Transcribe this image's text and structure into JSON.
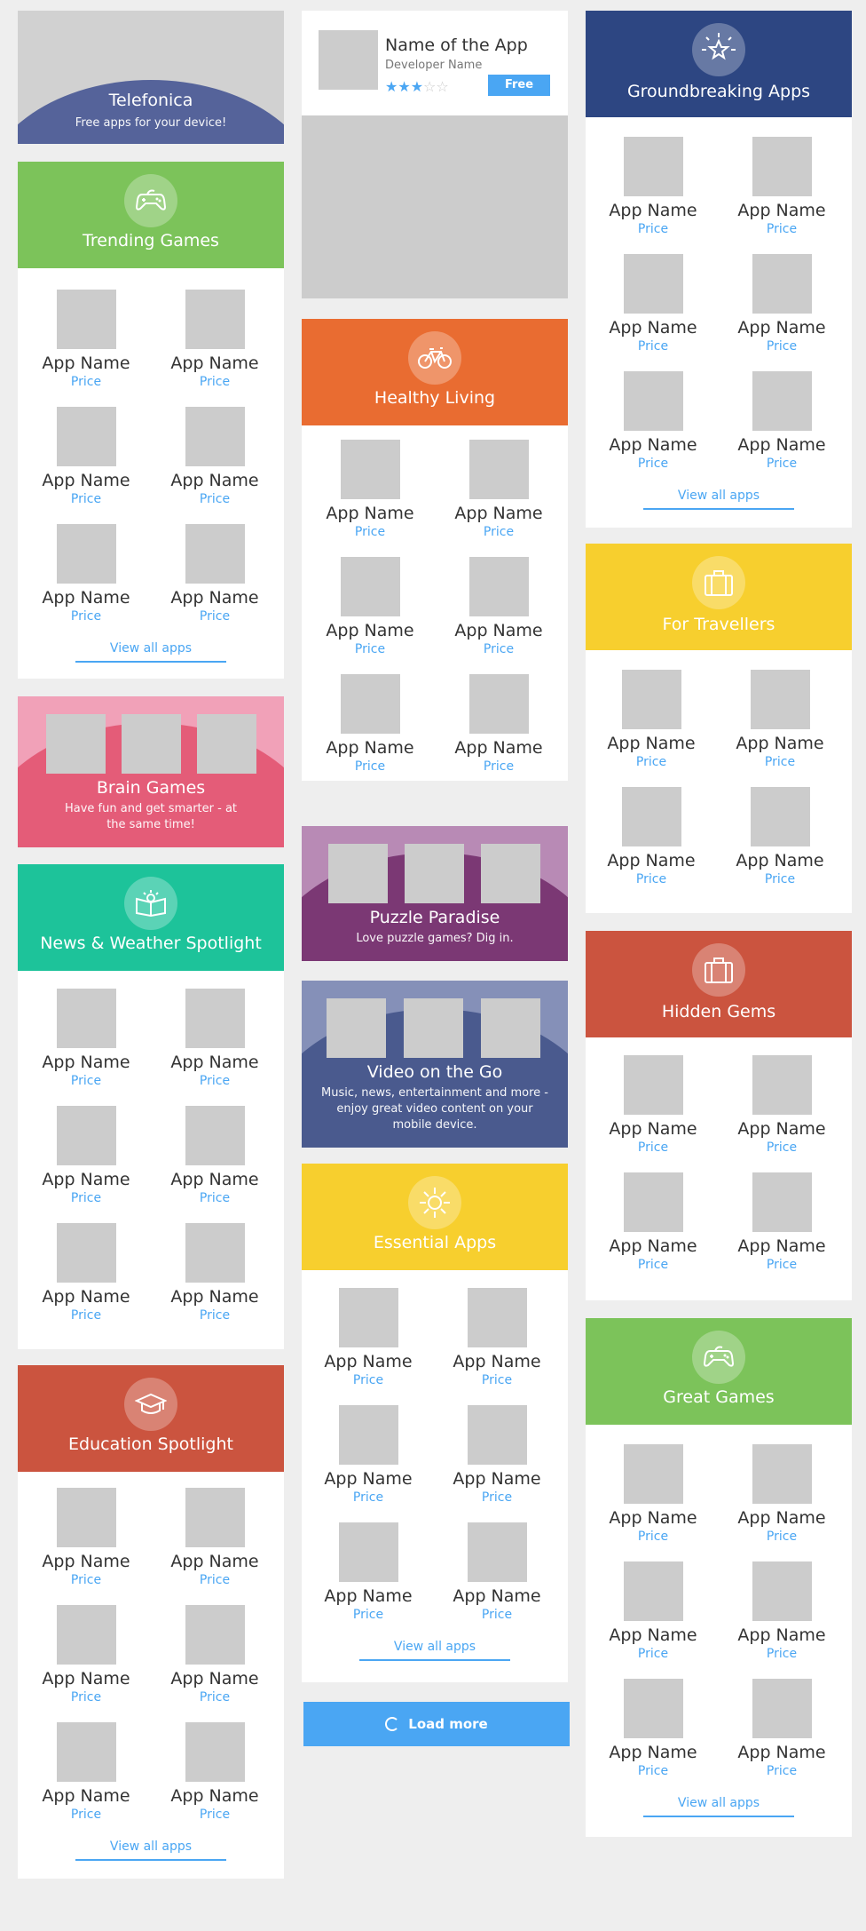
{
  "colors": {
    "green": "#7cc35a",
    "orange": "#e96c31",
    "teal": "#1dc39a",
    "red": "#cb543f",
    "navy": "#2d4682",
    "yellow": "#f7cf2e",
    "pink": "#e45c78",
    "purple": "#7b3874",
    "slate": "#4a5a8e",
    "link": "#4aa6f3",
    "placeholder": "#cccccc"
  },
  "telefonica": {
    "title": "Telefonica",
    "subtitle": "Free apps for your device!"
  },
  "featured": {
    "name": "Name of the App",
    "developer": "Developer Name",
    "rating": 3,
    "rating_max": 5,
    "button": "Free"
  },
  "app": {
    "name": "App Name",
    "price": "Price"
  },
  "view_all": "View all apps",
  "load_more": "Load more",
  "sections": {
    "trending": {
      "title": "Trending Games",
      "icon": "gamepad-icon"
    },
    "healthy": {
      "title": "Healthy Living",
      "icon": "bicycle-icon"
    },
    "groundbreaking": {
      "title": "Groundbreaking Apps",
      "icon": "star-burst-icon"
    },
    "travellers": {
      "title": "For Travellers",
      "icon": "suitcase-icon"
    },
    "hidden": {
      "title": "Hidden Gems",
      "icon": "suitcase-icon"
    },
    "news": {
      "title": "News & Weather Spotlight",
      "icon": "book-icon"
    },
    "essential": {
      "title": "Essential Apps",
      "icon": "sun-icon"
    },
    "education": {
      "title": "Education Spotlight",
      "icon": "graduation-cap-icon"
    },
    "great": {
      "title": "Great Games",
      "icon": "gamepad-icon"
    }
  },
  "banners": {
    "brain": {
      "title": "Brain Games",
      "subtitle": "Have fun and get smarter - at the same time!"
    },
    "puzzle": {
      "title": "Puzzle Paradise",
      "subtitle": "Love puzzle games? Dig in."
    },
    "video": {
      "title": "Video on the Go",
      "subtitle": "Music, news, entertainment and more - enjoy great video content on your mobile device."
    }
  }
}
